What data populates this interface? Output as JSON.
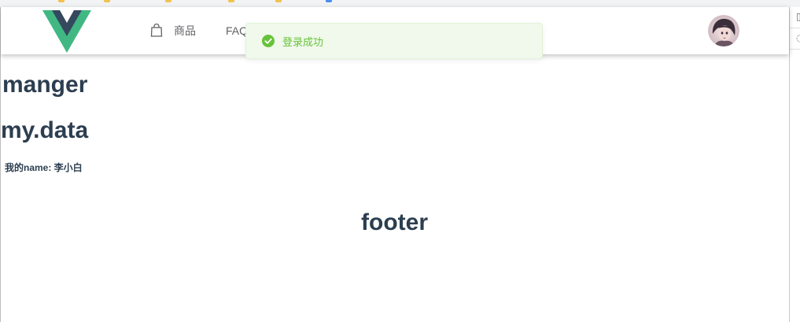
{
  "header": {
    "logo_icon": "vue-logo-icon",
    "nav": [
      {
        "label": "商品",
        "icon": "shopping-bag-icon"
      },
      {
        "label": "FAQ"
      }
    ],
    "avatar_icon": "user-avatar-icon"
  },
  "toast": {
    "message": "登录成功",
    "icon": "success-check-icon",
    "type": "success"
  },
  "main": {
    "heading_1": "manger",
    "heading_2": "my.data",
    "name_line": "我的name: 李小白"
  },
  "footer": {
    "title": "footer"
  },
  "colors": {
    "text": "#2c3e50",
    "nav_text": "#606266",
    "success": "#67c23a",
    "success_bg": "#f0f9eb",
    "vue_green": "#41b883",
    "vue_dark": "#34495e"
  }
}
